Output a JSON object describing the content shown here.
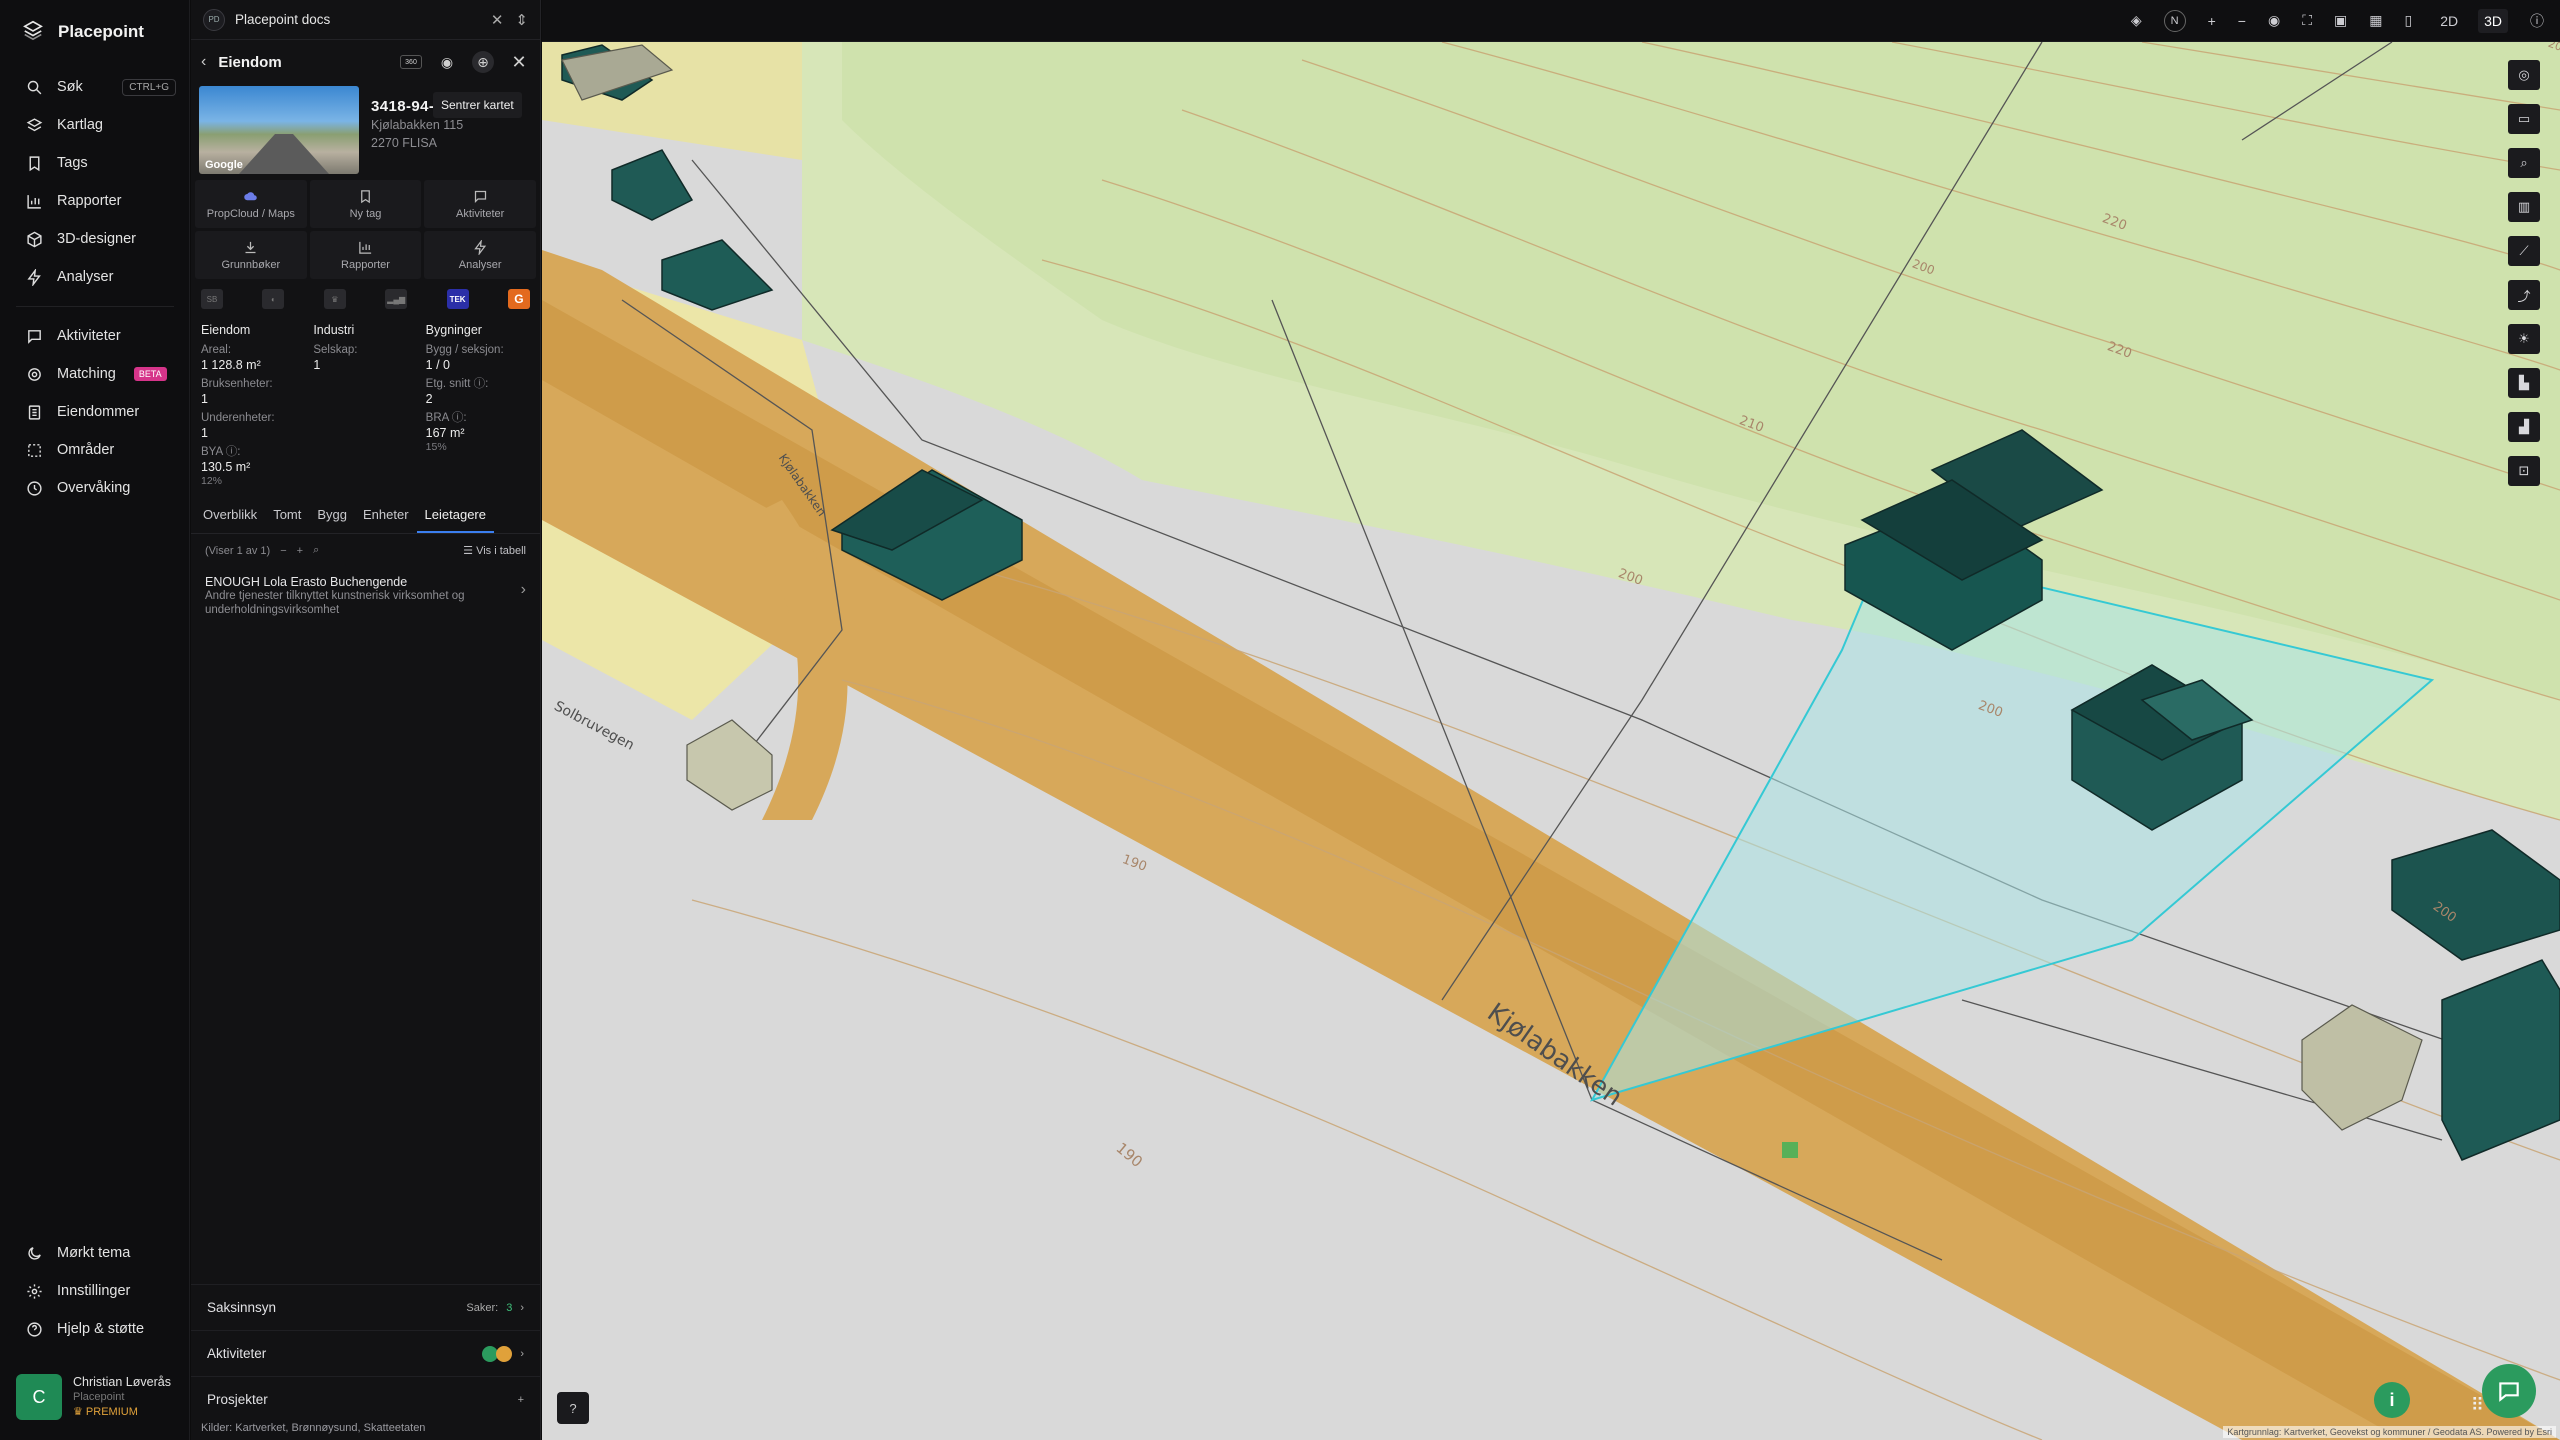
{
  "app": {
    "name": "Placepoint"
  },
  "sidebar": {
    "search_shortcut": "CTRL+G",
    "items": [
      {
        "id": "search",
        "label": "Søk",
        "icon": "search-icon"
      },
      {
        "id": "layers",
        "label": "Kartlag",
        "icon": "layers-icon"
      },
      {
        "id": "tags",
        "label": "Tags",
        "icon": "bookmark-icon"
      },
      {
        "id": "reports",
        "label": "Rapporter",
        "icon": "chart-icon"
      },
      {
        "id": "designer",
        "label": "3D-designer",
        "icon": "cube-icon"
      },
      {
        "id": "analyses",
        "label": "Analyser",
        "icon": "bolt-icon"
      }
    ],
    "items2": [
      {
        "id": "activities",
        "label": "Aktiviteter",
        "icon": "chat-icon"
      },
      {
        "id": "matching",
        "label": "Matching",
        "icon": "target-icon",
        "badge": "BETA"
      },
      {
        "id": "properties",
        "label": "Eiendommer",
        "icon": "building-icon"
      },
      {
        "id": "areas",
        "label": "Områder",
        "icon": "area-icon"
      },
      {
        "id": "monitoring",
        "label": "Overvåking",
        "icon": "clock-icon"
      }
    ],
    "bottom": [
      {
        "id": "theme",
        "label": "Mørkt tema",
        "icon": "moon-icon"
      },
      {
        "id": "settings",
        "label": "Innstillinger",
        "icon": "gear-icon"
      },
      {
        "id": "help",
        "label": "Hjelp & støtte",
        "icon": "help-icon"
      }
    ],
    "user": {
      "initial": "C",
      "name": "Christian Løverås",
      "org": "Placepoint",
      "tier": "PREMIUM"
    }
  },
  "workspace": {
    "badge": "PD",
    "name": "Placepoint docs"
  },
  "panel": {
    "title": "Eiendom",
    "tooltip": "Sentrer kartet",
    "property": {
      "id": "3418-94-",
      "street": "Kjølabakken 115",
      "postal": "2270 FLISA"
    },
    "thumb_credit": "Google",
    "actions": [
      {
        "label": "PropCloud / Maps",
        "icon": "cloud-icon"
      },
      {
        "label": "Ny tag",
        "icon": "bookmark-icon"
      },
      {
        "label": "Aktiviteter",
        "icon": "chat-icon"
      },
      {
        "label": "Grunnbøker",
        "icon": "download-icon"
      },
      {
        "label": "Rapporter",
        "icon": "chart-icon"
      },
      {
        "label": "Analyser",
        "icon": "bolt-icon"
      }
    ],
    "sources": {
      "tek": "TEK",
      "g": "G"
    },
    "facts": {
      "col1": {
        "heading": "Eiendom",
        "rows": [
          {
            "k": "Areal:",
            "v": "1 128.8 m²"
          },
          {
            "k": "Bruksenheter:",
            "v": "1"
          },
          {
            "k": "Underenheter:",
            "v": "1"
          },
          {
            "k": "BYA ⓘ:",
            "v": "130.5 m²",
            "sub": "12%"
          }
        ]
      },
      "col2": {
        "heading": "Industri",
        "rows": [
          {
            "k": "Selskap:",
            "v": "1"
          }
        ]
      },
      "col3": {
        "heading": "Bygninger",
        "rows": [
          {
            "k": "Bygg / seksjon:",
            "v": "1 / 0"
          },
          {
            "k": "Etg. snitt ⓘ:",
            "v": "2"
          },
          {
            "k": "BRA ⓘ:",
            "v": "167 m²",
            "sub": "15%"
          }
        ]
      }
    },
    "tabs": [
      "Overblikk",
      "Tomt",
      "Bygg",
      "Enheter",
      "Leietagere"
    ],
    "active_tab": "Leietagere",
    "paging": "(Viser 1 av 1)",
    "table_view": "Vis i tabell",
    "tenant": {
      "name": "ENOUGH Lola Erasto Buchengende",
      "desc": "Andre tjenester tilknyttet kunstnerisk virksomhet og underholdningsvirksomhet"
    },
    "rows": {
      "cases": {
        "label": "Saksinnsyn",
        "meta_label": "Saker:",
        "meta_value": "3"
      },
      "activities": {
        "label": "Aktiviteter"
      },
      "projects": {
        "label": "Prosjekter"
      }
    },
    "sources_footer": {
      "label": "Kilder:",
      "items": [
        "Kartverket,",
        "Brønnøysund,",
        "Skatteetaten"
      ]
    }
  },
  "toolbar": {
    "compass": "N",
    "zoom_in": "+",
    "zoom_out": "−",
    "mode_2d": "2D",
    "mode_3d": "3D"
  },
  "map": {
    "labels": {
      "road1": "Kjølabakken",
      "road2": "Solbruvegen",
      "road3": "Kjølabakken"
    },
    "contours": [
      "220",
      "210",
      "200",
      "200",
      "190",
      "190",
      "200",
      "220",
      "200",
      "200"
    ],
    "attribution": "Kartgrunnlag: Kartverket, Geovekst og kommuner / Geodata AS. Powered by Esri"
  }
}
